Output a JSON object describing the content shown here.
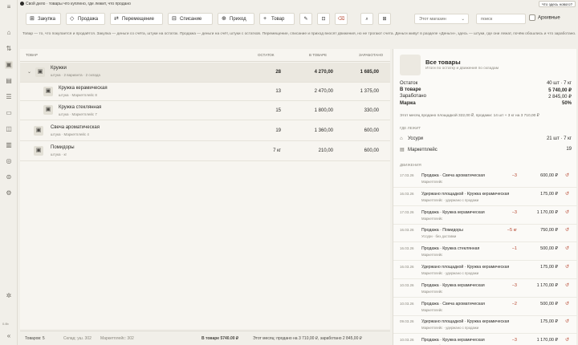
{
  "topbar": {
    "message": "Свой дело · товары что куплено, где лежит, что продано",
    "right_button": "Что здесь нового?"
  },
  "toolbar": {
    "buttons": [
      "Закупка",
      "Продажа",
      "Перемещение",
      "Списание",
      "Приход",
      "Товар"
    ],
    "warehouse_select": "Этот магазин",
    "search_placeholder": "поиск",
    "archive_label": "Архивные"
  },
  "description": "Товар — то, что покупается и продаётся. Закупка — деньги со счёта, штуки на остаток. Продажа — деньги на счёт, штуки с остатков. Перемещение, списание и приход вносят движения, но не трогают счета. Деньги живут в разделе «Деньги», здесь — штуки, где они лежат, почём обошлись и что заработано.",
  "table": {
    "headers": {
      "name": "ТОВАР",
      "stock": "ОСТАТОК",
      "in_goods": "В ТОВАРЕ",
      "earned": "ЗАРАБОТАНО"
    },
    "rows": [
      {
        "name": "Кружки",
        "sub": "штука · 2 варианта · 2 склада",
        "stock": "28",
        "in_goods": "4 270,00",
        "earned": "1 685,00"
      },
      {
        "name": "Кружка керамическая",
        "sub": "штука · Маркетплейс 8",
        "stock": "13",
        "in_goods": "2 470,00",
        "earned": "1 375,00"
      },
      {
        "name": "Кружка стеклянная",
        "sub": "штука · Маркетплейс 7",
        "stock": "15",
        "in_goods": "1 800,00",
        "earned": "330,00"
      },
      {
        "name": "Свеча ароматическая",
        "sub": "штука · Маркетплейс 4",
        "stock": "19",
        "in_goods": "1 360,00",
        "earned": "600,00"
      },
      {
        "name": "Помидоры",
        "sub": "штука · кг",
        "stock": "7 кг",
        "in_goods": "210,00",
        "earned": "600,00"
      }
    ]
  },
  "status": {
    "count": "Товаров: 5",
    "a": "Склад: уш. 302",
    "b": "Маркетплейс: 302",
    "total": "В товаре 5740.00 ₽",
    "month": "Этот месяц: продано на 3 710,00 ₽, заработано 2 845,00 ₽"
  },
  "panel": {
    "title": "Все товары",
    "subtitle": "Итоги по остатку и движения по складам",
    "kv": [
      [
        "Остаток",
        "40 шт · 7 кг"
      ],
      [
        "В товаре",
        "5 740,00 ₽"
      ],
      [
        "Заработано",
        "2 845,00 ₽"
      ],
      [
        "Маржа",
        "50%"
      ]
    ],
    "note": "Этот месяц продано площадкой 322,00 ₽, продажи: 14 шт + 3 кг на 3 710,00 ₽",
    "where_label": "ГДЕ ЛЕЖИТ",
    "locations": [
      [
        "Уссури",
        "21 шт · 7 кг"
      ],
      [
        "Маркетплейс",
        "19"
      ]
    ],
    "moves_label": "ДВИЖЕНИЯ",
    "moves": [
      {
        "date": "17.03.26",
        "title": "Продажа · Свеча ароматическая",
        "sub": "Маркетплейс",
        "qty": "−3",
        "sum": "600,00 ₽"
      },
      {
        "date": "16.03.26",
        "title": "Удержано площадкой · Кружка керамическая",
        "sub": "Маркетплейс · удержано с продажи",
        "qty": "",
        "sum": "175,00 ₽"
      },
      {
        "date": "17.03.26",
        "title": "Продажа · Кружка керамическая",
        "sub": "Маркетплейс",
        "qty": "−3",
        "sum": "1 170,00 ₽"
      },
      {
        "date": "16.03.26",
        "title": "Продажа · Помидоры",
        "sub": "Уссури · без доставки",
        "qty": "−5 кг",
        "sum": "750,00 ₽"
      },
      {
        "date": "16.03.26",
        "title": "Продажа · Кружка стеклянная",
        "sub": "Маркетплейс",
        "qty": "−1",
        "sum": "500,00 ₽"
      },
      {
        "date": "16.03.26",
        "title": "Удержано площадкой · Кружка керамическая",
        "sub": "Маркетплейс · удержано с продажи",
        "qty": "",
        "sum": "175,00 ₽"
      },
      {
        "date": "10.03.26",
        "title": "Продажа · Кружка керамическая",
        "sub": "Маркетплейс",
        "qty": "−3",
        "sum": "1 170,00 ₽"
      },
      {
        "date": "10.03.26",
        "title": "Продажа · Свеча ароматическая",
        "sub": "Маркетплейс",
        "qty": "−2",
        "sum": "500,00 ₽"
      },
      {
        "date": "09.03.26",
        "title": "Удержано площадкой · Кружка керамическая",
        "sub": "Маркетплейс · удержано с продажи",
        "qty": "",
        "sum": "175,00 ₽"
      },
      {
        "date": "10.03.26",
        "title": "Продажа · Кружка керамическая",
        "sub": "Маркетплейс",
        "qty": "−3",
        "sum": "1 170,00 ₽"
      }
    ]
  },
  "rail": {
    "version": "0.8b"
  },
  "colors": {
    "accent": "#b5432c",
    "bg": "#f1efe9",
    "panel": "#fbfaf7"
  }
}
